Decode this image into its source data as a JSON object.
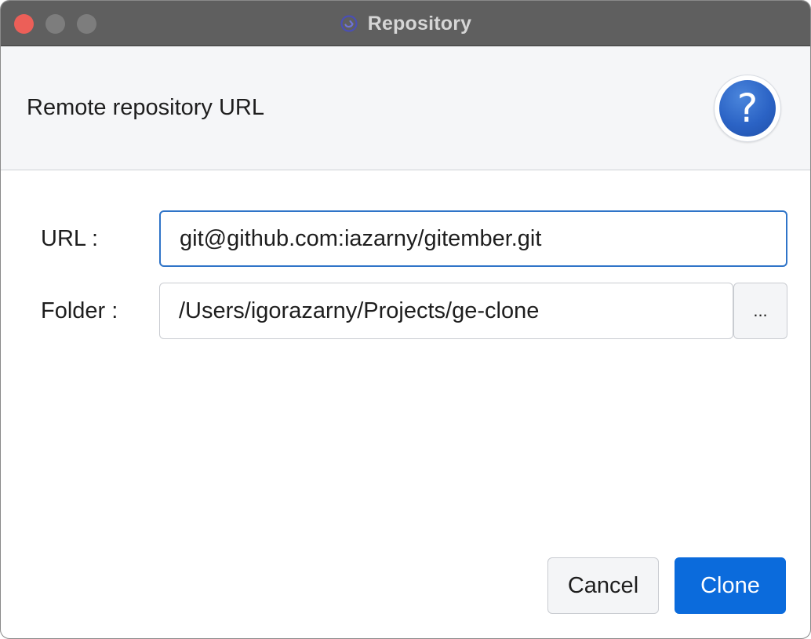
{
  "window": {
    "title": "Repository",
    "app_icon": "gitember-logo-icon"
  },
  "header": {
    "title": "Remote repository URL",
    "help_icon": "question-mark-icon",
    "help_glyph": "?"
  },
  "form": {
    "url_label": "URL :",
    "url_value": "git@github.com:iazarny/gitember.git",
    "folder_label": "Folder :",
    "folder_value": "/Users/igorazarny/Projects/ge-clone",
    "browse_label": "..."
  },
  "actions": {
    "cancel_label": "Cancel",
    "clone_label": "Clone"
  },
  "colors": {
    "primary": "#0b6bdc",
    "focus_border": "#2f74c8",
    "titlebar": "#5f5f5f",
    "close_dot": "#ec5f58"
  }
}
